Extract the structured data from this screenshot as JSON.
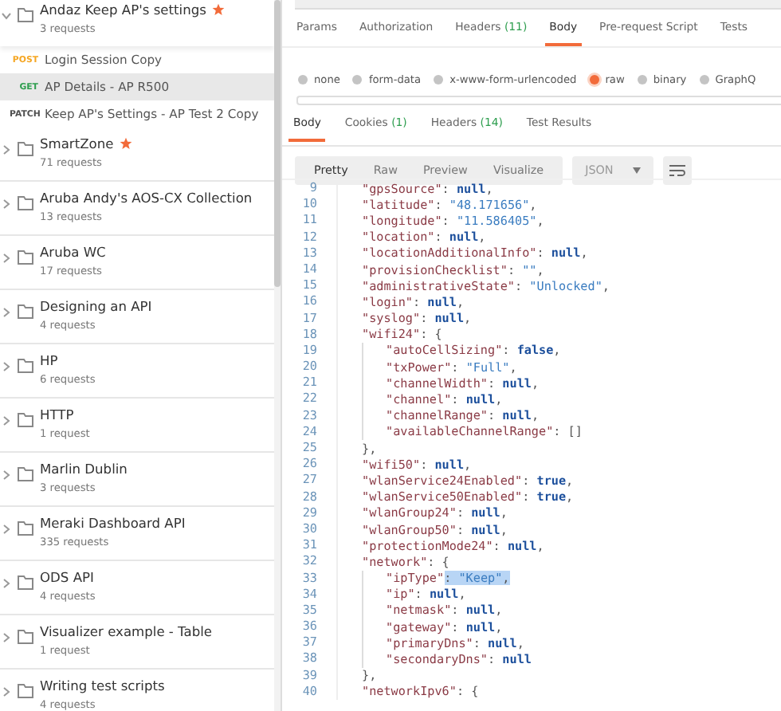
{
  "sidebar": {
    "collections": [
      {
        "name": "Andaz Keep AP's settings",
        "count": "3 requests",
        "starred": true,
        "expanded": true,
        "requests": [
          {
            "method": "POST",
            "color": "#f5a623",
            "name": "Login Session Copy",
            "selected": false
          },
          {
            "method": "GET",
            "color": "#2e9e4f",
            "name": "AP Details - AP R500",
            "selected": true
          },
          {
            "method": "PATCH",
            "color": "#505050",
            "name": "Keep AP's Settings - AP Test 2 Copy",
            "selected": false
          }
        ]
      },
      {
        "name": "SmartZone",
        "count": "71 requests",
        "starred": true,
        "expanded": false
      },
      {
        "name": "Aruba Andy's AOS-CX Collection",
        "count": "13 requests",
        "starred": false,
        "expanded": false
      },
      {
        "name": "Aruba WC",
        "count": "17 requests",
        "starred": false,
        "expanded": false
      },
      {
        "name": "Designing an API",
        "count": "4 requests",
        "starred": false,
        "expanded": false
      },
      {
        "name": "HP",
        "count": "6 requests",
        "starred": false,
        "expanded": false
      },
      {
        "name": "HTTP",
        "count": "1 request",
        "starred": false,
        "expanded": false
      },
      {
        "name": "Marlin Dublin",
        "count": "3 requests",
        "starred": false,
        "expanded": false
      },
      {
        "name": "Meraki Dashboard API",
        "count": "335 requests",
        "starred": false,
        "expanded": false
      },
      {
        "name": "ODS API",
        "count": "4 requests",
        "starred": false,
        "expanded": false
      },
      {
        "name": "Visualizer example - Table",
        "count": "1 request",
        "starred": false,
        "expanded": false
      },
      {
        "name": "Writing test scripts",
        "count": "4 requests",
        "starred": false,
        "expanded": false
      }
    ]
  },
  "request_tabs": [
    {
      "label": "Params",
      "selected": false
    },
    {
      "label": "Authorization",
      "selected": false
    },
    {
      "label": "Headers",
      "count": "(11)",
      "selected": false
    },
    {
      "label": "Body",
      "selected": true
    },
    {
      "label": "Pre-request Script",
      "selected": false
    },
    {
      "label": "Tests",
      "selected": false
    }
  ],
  "body_types": [
    {
      "label": "none",
      "selected": false
    },
    {
      "label": "form-data",
      "selected": false
    },
    {
      "label": "x-www-form-urlencoded",
      "selected": false
    },
    {
      "label": "raw",
      "selected": true
    },
    {
      "label": "binary",
      "selected": false
    },
    {
      "label": "GraphQ",
      "selected": false
    }
  ],
  "response_tabs": [
    {
      "label": "Body",
      "selected": true
    },
    {
      "label": "Cookies",
      "count": "(1)",
      "selected": false
    },
    {
      "label": "Headers",
      "count": "(14)",
      "selected": false
    },
    {
      "label": "Test Results",
      "selected": false
    }
  ],
  "view_modes": [
    {
      "label": "Pretty",
      "selected": true
    },
    {
      "label": "Raw",
      "selected": false
    },
    {
      "label": "Preview",
      "selected": false
    },
    {
      "label": "Visualize",
      "selected": false
    }
  ],
  "format": "JSON",
  "code_lines": [
    {
      "number": "9",
      "nested": false,
      "tokens": [
        {
          "kind": "key",
          "text": "\"gpsSource\""
        },
        {
          "kind": "punct",
          "text": ": "
        },
        {
          "kind": "literal",
          "text": "null"
        },
        {
          "kind": "punct",
          "text": ","
        }
      ]
    },
    {
      "number": "10",
      "nested": false,
      "tokens": [
        {
          "kind": "key",
          "text": "\"latitude\""
        },
        {
          "kind": "punct",
          "text": ": "
        },
        {
          "kind": "string",
          "text": "\"48.171656\""
        },
        {
          "kind": "punct",
          "text": ","
        }
      ]
    },
    {
      "number": "11",
      "nested": false,
      "tokens": [
        {
          "kind": "key",
          "text": "\"longitude\""
        },
        {
          "kind": "punct",
          "text": ": "
        },
        {
          "kind": "string",
          "text": "\"11.586405\""
        },
        {
          "kind": "punct",
          "text": ","
        }
      ]
    },
    {
      "number": "12",
      "nested": false,
      "tokens": [
        {
          "kind": "key",
          "text": "\"location\""
        },
        {
          "kind": "punct",
          "text": ": "
        },
        {
          "kind": "literal",
          "text": "null"
        },
        {
          "kind": "punct",
          "text": ","
        }
      ]
    },
    {
      "number": "13",
      "nested": false,
      "tokens": [
        {
          "kind": "key",
          "text": "\"locationAdditionalInfo\""
        },
        {
          "kind": "punct",
          "text": ": "
        },
        {
          "kind": "literal",
          "text": "null"
        },
        {
          "kind": "punct",
          "text": ","
        }
      ]
    },
    {
      "number": "14",
      "nested": false,
      "tokens": [
        {
          "kind": "key",
          "text": "\"provisionChecklist\""
        },
        {
          "kind": "punct",
          "text": ": "
        },
        {
          "kind": "string",
          "text": "\"\""
        },
        {
          "kind": "punct",
          "text": ","
        }
      ]
    },
    {
      "number": "15",
      "nested": false,
      "tokens": [
        {
          "kind": "key",
          "text": "\"administrativeState\""
        },
        {
          "kind": "punct",
          "text": ": "
        },
        {
          "kind": "string",
          "text": "\"Unlocked\""
        },
        {
          "kind": "punct",
          "text": ","
        }
      ]
    },
    {
      "number": "16",
      "nested": false,
      "tokens": [
        {
          "kind": "key",
          "text": "\"login\""
        },
        {
          "kind": "punct",
          "text": ": "
        },
        {
          "kind": "literal",
          "text": "null"
        },
        {
          "kind": "punct",
          "text": ","
        }
      ]
    },
    {
      "number": "17",
      "nested": false,
      "tokens": [
        {
          "kind": "key",
          "text": "\"syslog\""
        },
        {
          "kind": "punct",
          "text": ": "
        },
        {
          "kind": "literal",
          "text": "null"
        },
        {
          "kind": "punct",
          "text": ","
        }
      ]
    },
    {
      "number": "18",
      "nested": false,
      "tokens": [
        {
          "kind": "key",
          "text": "\"wifi24\""
        },
        {
          "kind": "punct",
          "text": ": {"
        }
      ]
    },
    {
      "number": "19",
      "nested": true,
      "tokens": [
        {
          "kind": "key",
          "text": "\"autoCellSizing\""
        },
        {
          "kind": "punct",
          "text": ": "
        },
        {
          "kind": "literal",
          "text": "false"
        },
        {
          "kind": "punct",
          "text": ","
        }
      ]
    },
    {
      "number": "20",
      "nested": true,
      "tokens": [
        {
          "kind": "key",
          "text": "\"txPower\""
        },
        {
          "kind": "punct",
          "text": ": "
        },
        {
          "kind": "string",
          "text": "\"Full\""
        },
        {
          "kind": "punct",
          "text": ","
        }
      ]
    },
    {
      "number": "21",
      "nested": true,
      "tokens": [
        {
          "kind": "key",
          "text": "\"channelWidth\""
        },
        {
          "kind": "punct",
          "text": ": "
        },
        {
          "kind": "literal",
          "text": "null"
        },
        {
          "kind": "punct",
          "text": ","
        }
      ]
    },
    {
      "number": "22",
      "nested": true,
      "tokens": [
        {
          "kind": "key",
          "text": "\"channel\""
        },
        {
          "kind": "punct",
          "text": ": "
        },
        {
          "kind": "literal",
          "text": "null"
        },
        {
          "kind": "punct",
          "text": ","
        }
      ]
    },
    {
      "number": "23",
      "nested": true,
      "tokens": [
        {
          "kind": "key",
          "text": "\"channelRange\""
        },
        {
          "kind": "punct",
          "text": ": "
        },
        {
          "kind": "literal",
          "text": "null"
        },
        {
          "kind": "punct",
          "text": ","
        }
      ]
    },
    {
      "number": "24",
      "nested": true,
      "tokens": [
        {
          "kind": "key",
          "text": "\"availableChannelRange\""
        },
        {
          "kind": "punct",
          "text": ": []"
        }
      ]
    },
    {
      "number": "25",
      "nested": false,
      "tokens": [
        {
          "kind": "punct",
          "text": "},"
        }
      ]
    },
    {
      "number": "26",
      "nested": false,
      "tokens": [
        {
          "kind": "key",
          "text": "\"wifi50\""
        },
        {
          "kind": "punct",
          "text": ": "
        },
        {
          "kind": "literal",
          "text": "null"
        },
        {
          "kind": "punct",
          "text": ","
        }
      ]
    },
    {
      "number": "27",
      "nested": false,
      "tokens": [
        {
          "kind": "key",
          "text": "\"wlanService24Enabled\""
        },
        {
          "kind": "punct",
          "text": ": "
        },
        {
          "kind": "literal",
          "text": "true"
        },
        {
          "kind": "punct",
          "text": ","
        }
      ]
    },
    {
      "number": "28",
      "nested": false,
      "tokens": [
        {
          "kind": "key",
          "text": "\"wlanService50Enabled\""
        },
        {
          "kind": "punct",
          "text": ": "
        },
        {
          "kind": "literal",
          "text": "true"
        },
        {
          "kind": "punct",
          "text": ","
        }
      ]
    },
    {
      "number": "29",
      "nested": false,
      "tokens": [
        {
          "kind": "key",
          "text": "\"wlanGroup24\""
        },
        {
          "kind": "punct",
          "text": ": "
        },
        {
          "kind": "literal",
          "text": "null"
        },
        {
          "kind": "punct",
          "text": ","
        }
      ]
    },
    {
      "number": "30",
      "nested": false,
      "tokens": [
        {
          "kind": "key",
          "text": "\"wlanGroup50\""
        },
        {
          "kind": "punct",
          "text": ": "
        },
        {
          "kind": "literal",
          "text": "null"
        },
        {
          "kind": "punct",
          "text": ","
        }
      ]
    },
    {
      "number": "31",
      "nested": false,
      "tokens": [
        {
          "kind": "key",
          "text": "\"protectionMode24\""
        },
        {
          "kind": "punct",
          "text": ": "
        },
        {
          "kind": "literal",
          "text": "null"
        },
        {
          "kind": "punct",
          "text": ","
        }
      ]
    },
    {
      "number": "32",
      "nested": false,
      "tokens": [
        {
          "kind": "key",
          "text": "\"network\""
        },
        {
          "kind": "punct",
          "text": ": {"
        }
      ]
    },
    {
      "number": "33",
      "nested": true,
      "tokens": [
        {
          "kind": "key",
          "text": "\"ipType\""
        },
        {
          "kind": "punct",
          "text": ": ",
          "selected": true
        },
        {
          "kind": "string",
          "text": "\"Keep\"",
          "selected": true
        },
        {
          "kind": "punct",
          "text": ",",
          "selected": true
        }
      ]
    },
    {
      "number": "34",
      "nested": true,
      "tokens": [
        {
          "kind": "key",
          "text": "\"ip\""
        },
        {
          "kind": "punct",
          "text": ": "
        },
        {
          "kind": "literal",
          "text": "null"
        },
        {
          "kind": "punct",
          "text": ","
        }
      ]
    },
    {
      "number": "35",
      "nested": true,
      "tokens": [
        {
          "kind": "key",
          "text": "\"netmask\""
        },
        {
          "kind": "punct",
          "text": ": "
        },
        {
          "kind": "literal",
          "text": "null"
        },
        {
          "kind": "punct",
          "text": ","
        }
      ]
    },
    {
      "number": "36",
      "nested": true,
      "tokens": [
        {
          "kind": "key",
          "text": "\"gateway\""
        },
        {
          "kind": "punct",
          "text": ": "
        },
        {
          "kind": "literal",
          "text": "null"
        },
        {
          "kind": "punct",
          "text": ","
        }
      ]
    },
    {
      "number": "37",
      "nested": true,
      "tokens": [
        {
          "kind": "key",
          "text": "\"primaryDns\""
        },
        {
          "kind": "punct",
          "text": ": "
        },
        {
          "kind": "literal",
          "text": "null"
        },
        {
          "kind": "punct",
          "text": ","
        }
      ]
    },
    {
      "number": "38",
      "nested": true,
      "tokens": [
        {
          "kind": "key",
          "text": "\"secondaryDns\""
        },
        {
          "kind": "punct",
          "text": ": "
        },
        {
          "kind": "literal",
          "text": "null"
        }
      ]
    },
    {
      "number": "39",
      "nested": false,
      "tokens": [
        {
          "kind": "punct",
          "text": "},"
        }
      ]
    },
    {
      "number": "40",
      "nested": false,
      "tokens": [
        {
          "kind": "key",
          "text": "\"networkIpv6\""
        },
        {
          "kind": "punct",
          "text": ": {"
        }
      ]
    }
  ]
}
